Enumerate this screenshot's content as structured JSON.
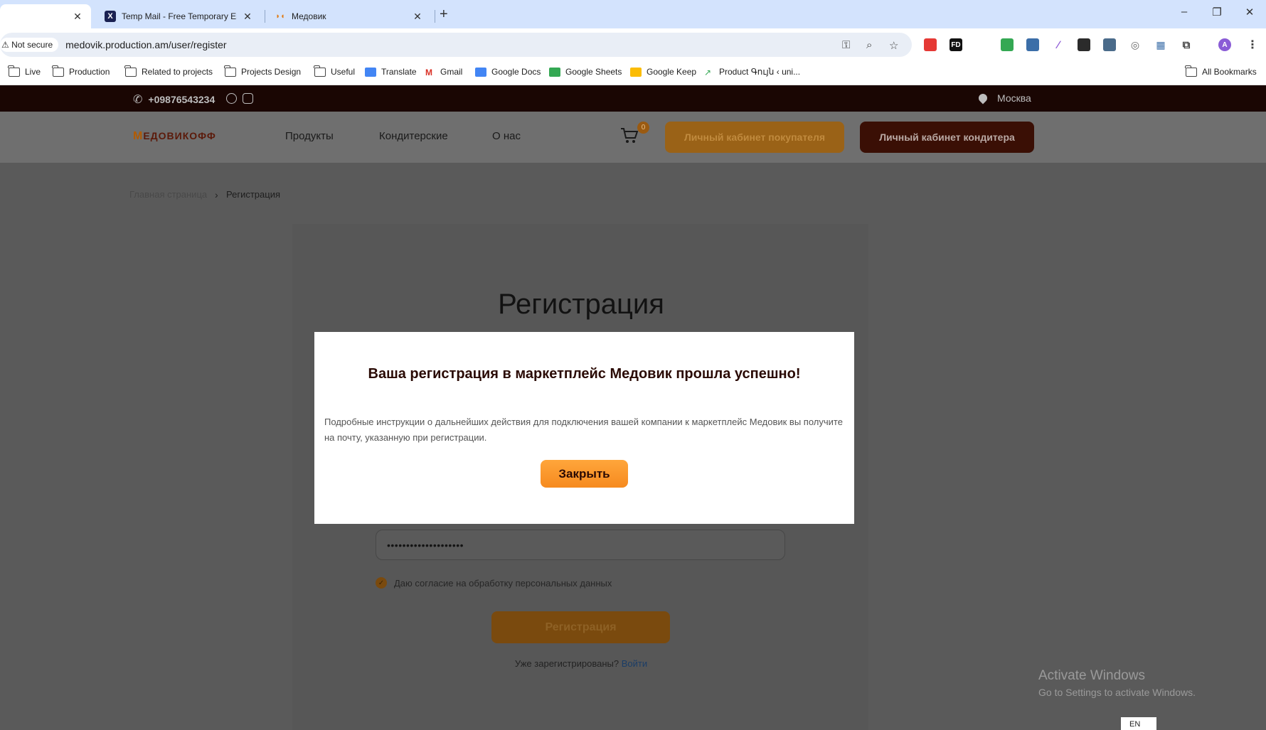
{
  "browser": {
    "tabs": [
      {
        "title": "",
        "active": true
      },
      {
        "title": "Temp Mail - Free Temporary Em",
        "active": false,
        "favicon": "X"
      },
      {
        "title": "Медовик",
        "active": false
      }
    ],
    "new_tab": "+",
    "window_controls": [
      "–",
      "❐",
      "✕"
    ],
    "security_label": "Not secure",
    "url": "medovik.production.am/user/register",
    "bookmarks": [
      {
        "label": "Live",
        "icon": "folder-icon"
      },
      {
        "label": "Production",
        "icon": "folder-icon"
      },
      {
        "label": "Related to projects",
        "icon": "folder-icon"
      },
      {
        "label": "Projects Design",
        "icon": "folder-icon"
      },
      {
        "label": "Useful",
        "icon": "folder-icon"
      },
      {
        "label": "Translate",
        "icon": "translate-icon"
      },
      {
        "label": "Gmail",
        "icon": "gmail-icon"
      },
      {
        "label": "Google Docs",
        "icon": "docs-icon"
      },
      {
        "label": "Google Sheets",
        "icon": "sheets-icon"
      },
      {
        "label": "Google Keep",
        "icon": "keep-icon"
      },
      {
        "label": "Product Գույն ‹ uni...",
        "icon": "chart-icon"
      }
    ],
    "all_bookmarks": "All Bookmarks",
    "profile_initial": "A"
  },
  "site": {
    "phone": "+09876543234",
    "city": "Москва",
    "logo": "ЕДОВИКОФФ",
    "nav": [
      "Продукты",
      "Кондитерские",
      "О нас"
    ],
    "cart_count": "0",
    "buyer_button": "Личный кабинет покупателя",
    "baker_button": "Личный кабинет кондитера",
    "breadcrumb_home": "Главная страница",
    "breadcrumb_current": "Регистрация",
    "page_title": "Регистрация",
    "password_value": "••••••••••••••••••••",
    "consent_label": "Даю согласие на обработку персональных данных",
    "register_button": "Регистрация",
    "already_text": "Уже зарегистрированы?",
    "login_link": "Войти"
  },
  "modal": {
    "title": "Ваша регистрация в маркетплейс Медовик прошла успешно!",
    "text": "Подробные инструкции о дальнейших действия для подключения вашей компании к маркетплейс Медовик вы получите на почту, указанную при регистрации.",
    "close_button": "Закрыть"
  },
  "os": {
    "activate_title": "Activate Windows",
    "activate_sub": "Go to Settings to activate Windows.",
    "language": "EN"
  },
  "colors": {
    "accent_orange": "#f68a1f",
    "brand_dark": "#2a0a04"
  }
}
